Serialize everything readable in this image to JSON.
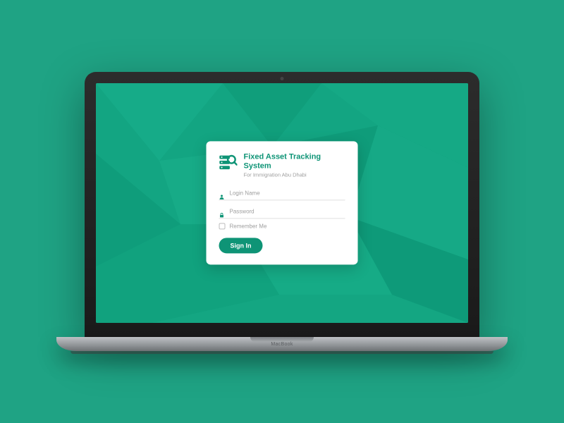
{
  "brand": {
    "title": "Fixed Asset Tracking System",
    "subtitle": "For Immigration Abu Dhabi"
  },
  "form": {
    "login_placeholder": "Login Name",
    "password_placeholder": "Password",
    "remember_label": "Remember Me",
    "signin_label": "Sign In"
  },
  "device": {
    "label": "MacBook"
  },
  "colors": {
    "accent": "#0e9476",
    "bg": "#1fa384"
  }
}
